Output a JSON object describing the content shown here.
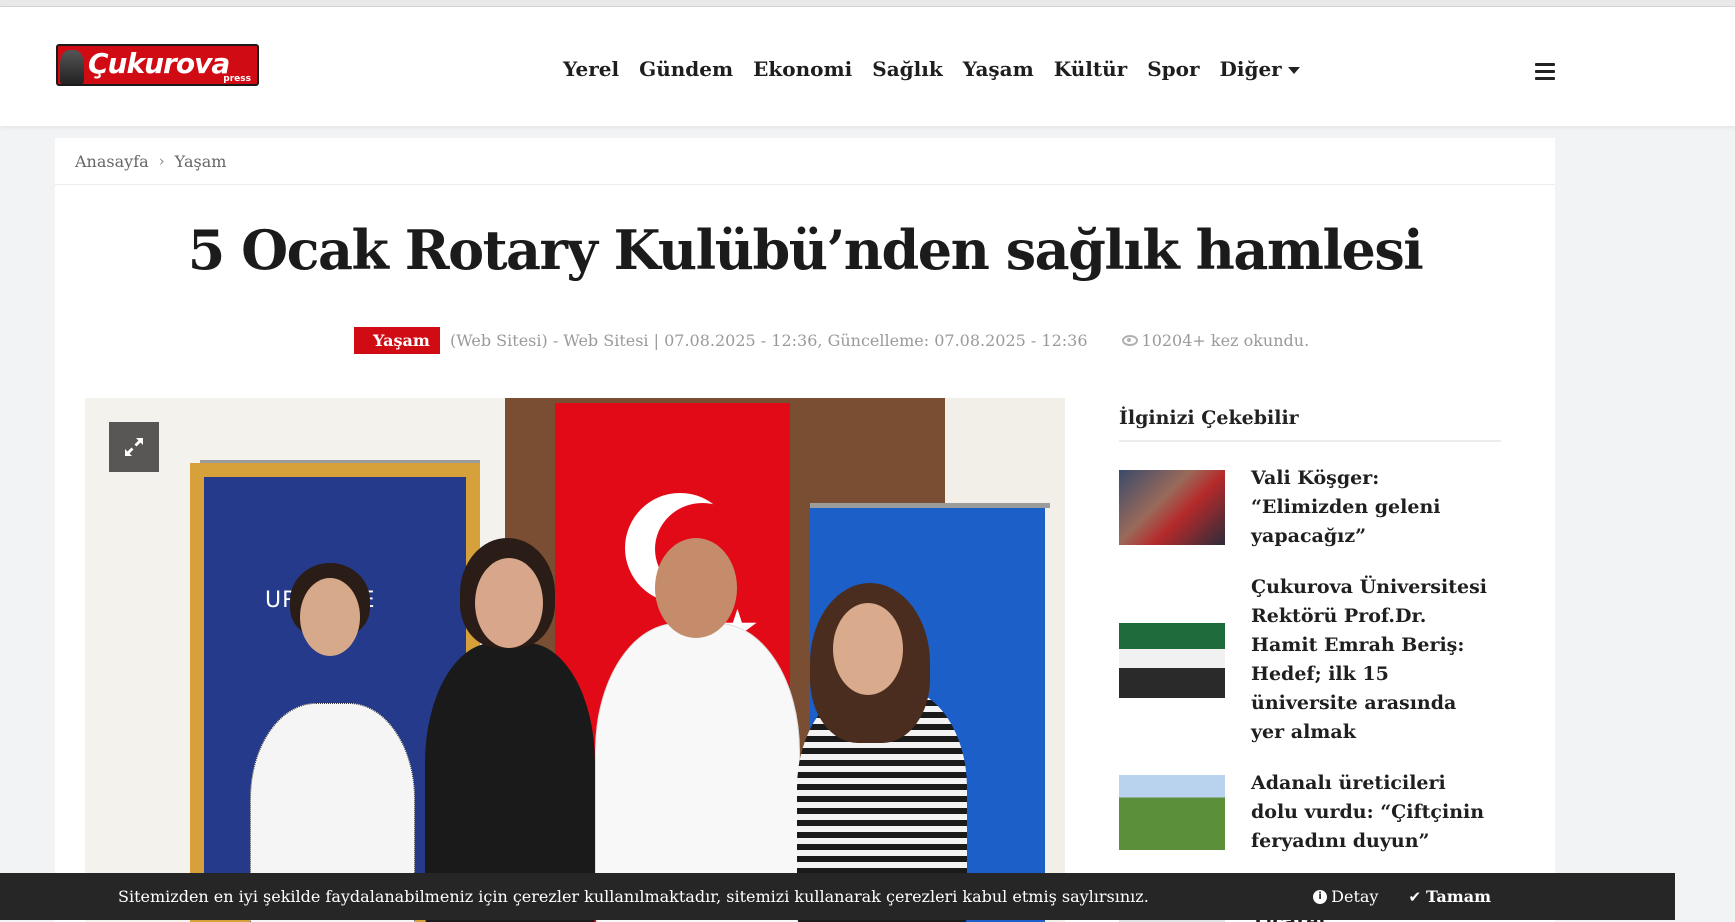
{
  "header": {
    "logo_text": "Çukurova",
    "logo_sub": "press",
    "nav": [
      "Yerel",
      "Gündem",
      "Ekonomi",
      "Sağlık",
      "Yaşam",
      "Kültür",
      "Spor",
      "Diğer"
    ]
  },
  "breadcrumb": {
    "home": "Anasayfa",
    "current": "Yaşam"
  },
  "article": {
    "title": "5 Ocak Rotary Kulübü’nden sağlık hamlesi",
    "category": "Yaşam",
    "meta": "(Web Sitesi) - Web Sitesi | 07.08.2025 - 12:36, Güncelleme: 07.08.2025 - 12:36",
    "views": "10204+ kez okundu.",
    "photo_banner_text": "UR 2    LGE"
  },
  "sidebar": {
    "title": "İlginizi Çekebilir",
    "items": [
      {
        "title": "Vali Köşger: “Elimizden geleni yapacağız”"
      },
      {
        "title": "Çukurova Üniversitesi Rektörü Prof.Dr. Hamit Emrah Beriş: Hedef; ilk 15 üniversite arasında yer almak"
      },
      {
        "title": "Adanalı üreticileri dolu vurdu: “Çiftçinin feryadını duyun”"
      },
      {
        "title": "Ceyhan’a Deniz Ticaret"
      }
    ]
  },
  "cookie": {
    "message": "Sitemizden en iyi şekilde faydalanabilmeniz için çerezler kullanılmaktadır, sitemizi kullanarak çerezleri kabul etmiş saylırsınız.",
    "detail_label": "Detay",
    "ok_label": "Tamam"
  },
  "colors": {
    "brand_red": "#d10b14",
    "cookie_bg": "#262626"
  }
}
